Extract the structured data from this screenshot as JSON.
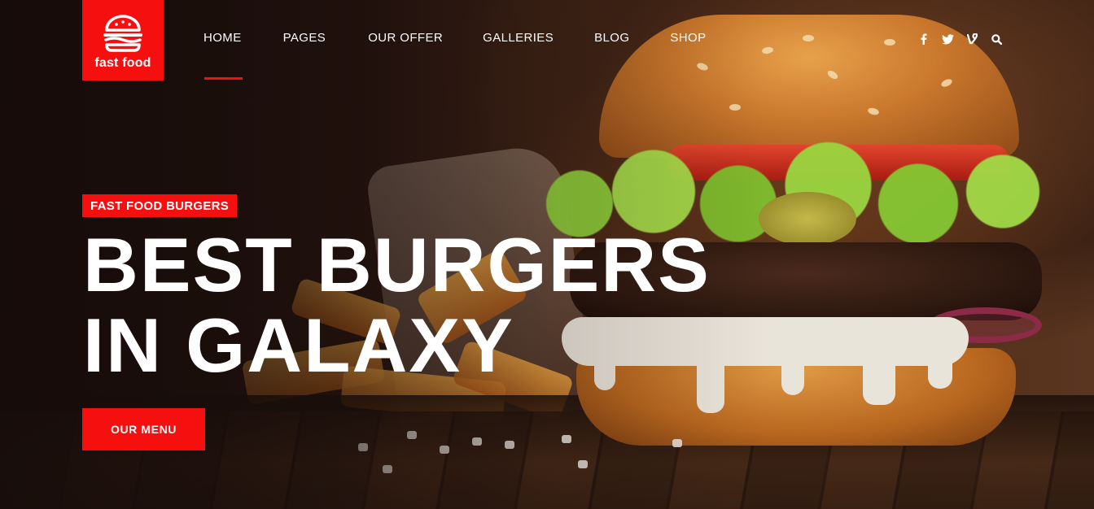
{
  "brand": {
    "logo_text": "fast food",
    "accent_color": "#f50f0f"
  },
  "nav": {
    "items": [
      {
        "label": "HOME",
        "active": true
      },
      {
        "label": "PAGES",
        "active": false
      },
      {
        "label": "OUR OFFER",
        "active": false
      },
      {
        "label": "GALLERIES",
        "active": false
      },
      {
        "label": "BLOG",
        "active": false
      },
      {
        "label": "SHOP",
        "active": false
      }
    ]
  },
  "social_icons": [
    "facebook-icon",
    "twitter-icon",
    "vine-icon",
    "search-icon"
  ],
  "hero": {
    "tag": "FAST FOOD BURGERS",
    "headline_line1": "BEST BURGERS",
    "headline_line2": "IN GALAXY",
    "cta_label": "OUR MENU"
  }
}
